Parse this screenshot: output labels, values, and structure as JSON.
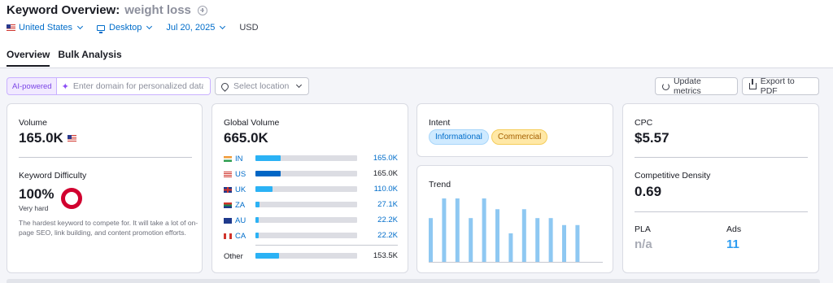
{
  "header": {
    "title": "Keyword Overview:",
    "keyword": "weight loss",
    "filters": {
      "country": "United States",
      "device": "Desktop",
      "date": "Jul 20, 2025",
      "currency": "USD"
    }
  },
  "tabs": [
    {
      "label": "Overview",
      "active": true
    },
    {
      "label": "Bulk Analysis",
      "active": false
    }
  ],
  "toolbar": {
    "ai_label": "AI-powered",
    "domain_placeholder": "Enter domain for personalized data",
    "location_placeholder": "Select location",
    "update_label": "Update metrics",
    "export_label": "Export to PDF"
  },
  "volume": {
    "label": "Volume",
    "value": "165.0K"
  },
  "difficulty": {
    "label": "Keyword Difficulty",
    "value": "100%",
    "level": "Very hard",
    "description": "The hardest keyword to compete for. It will take a lot of on-page SEO, link building, and content promotion efforts.",
    "fraction": 1.0,
    "color": "#d1002f"
  },
  "global_volume": {
    "label": "Global Volume",
    "value": "665.0K",
    "countries": [
      {
        "code": "IN",
        "value": "165.0K",
        "share": 0.25,
        "flag": "in-flag-icon"
      },
      {
        "code": "US",
        "value": "165.0K",
        "share": 0.25,
        "flag": "us-flag-icon"
      },
      {
        "code": "UK",
        "value": "110.0K",
        "share": 0.165,
        "flag": "uk-flag-icon"
      },
      {
        "code": "ZA",
        "value": "27.1K",
        "share": 0.04,
        "flag": "za-flag-icon"
      },
      {
        "code": "AU",
        "value": "22.2K",
        "share": 0.035,
        "flag": "au-flag-icon"
      },
      {
        "code": "CA",
        "value": "22.2K",
        "share": 0.035,
        "flag": "ca-flag-icon"
      }
    ],
    "other": {
      "label": "Other",
      "value": "153.5K",
      "share": 0.23
    }
  },
  "intent": {
    "label": "Intent",
    "tags": [
      "Informational",
      "Commercial"
    ]
  },
  "trend": {
    "label": "Trend",
    "values": [
      0.69,
      1.0,
      1.0,
      0.69,
      1.0,
      0.83,
      0.45,
      0.83,
      0.69,
      0.69,
      0.58,
      0.58
    ]
  },
  "cpc": {
    "label": "CPC",
    "value": "$5.57"
  },
  "competitive_density": {
    "label": "Competitive Density",
    "value": "0.69"
  },
  "pla": {
    "label": "PLA",
    "value": "n/a"
  },
  "ads": {
    "label": "Ads",
    "value": "11"
  },
  "colors": {
    "accent": "#006dca",
    "bar_light": "#2bb2f5",
    "bar_dark": "#0066c5",
    "trend_bar": "#8ec8f2",
    "danger": "#d1002f"
  }
}
